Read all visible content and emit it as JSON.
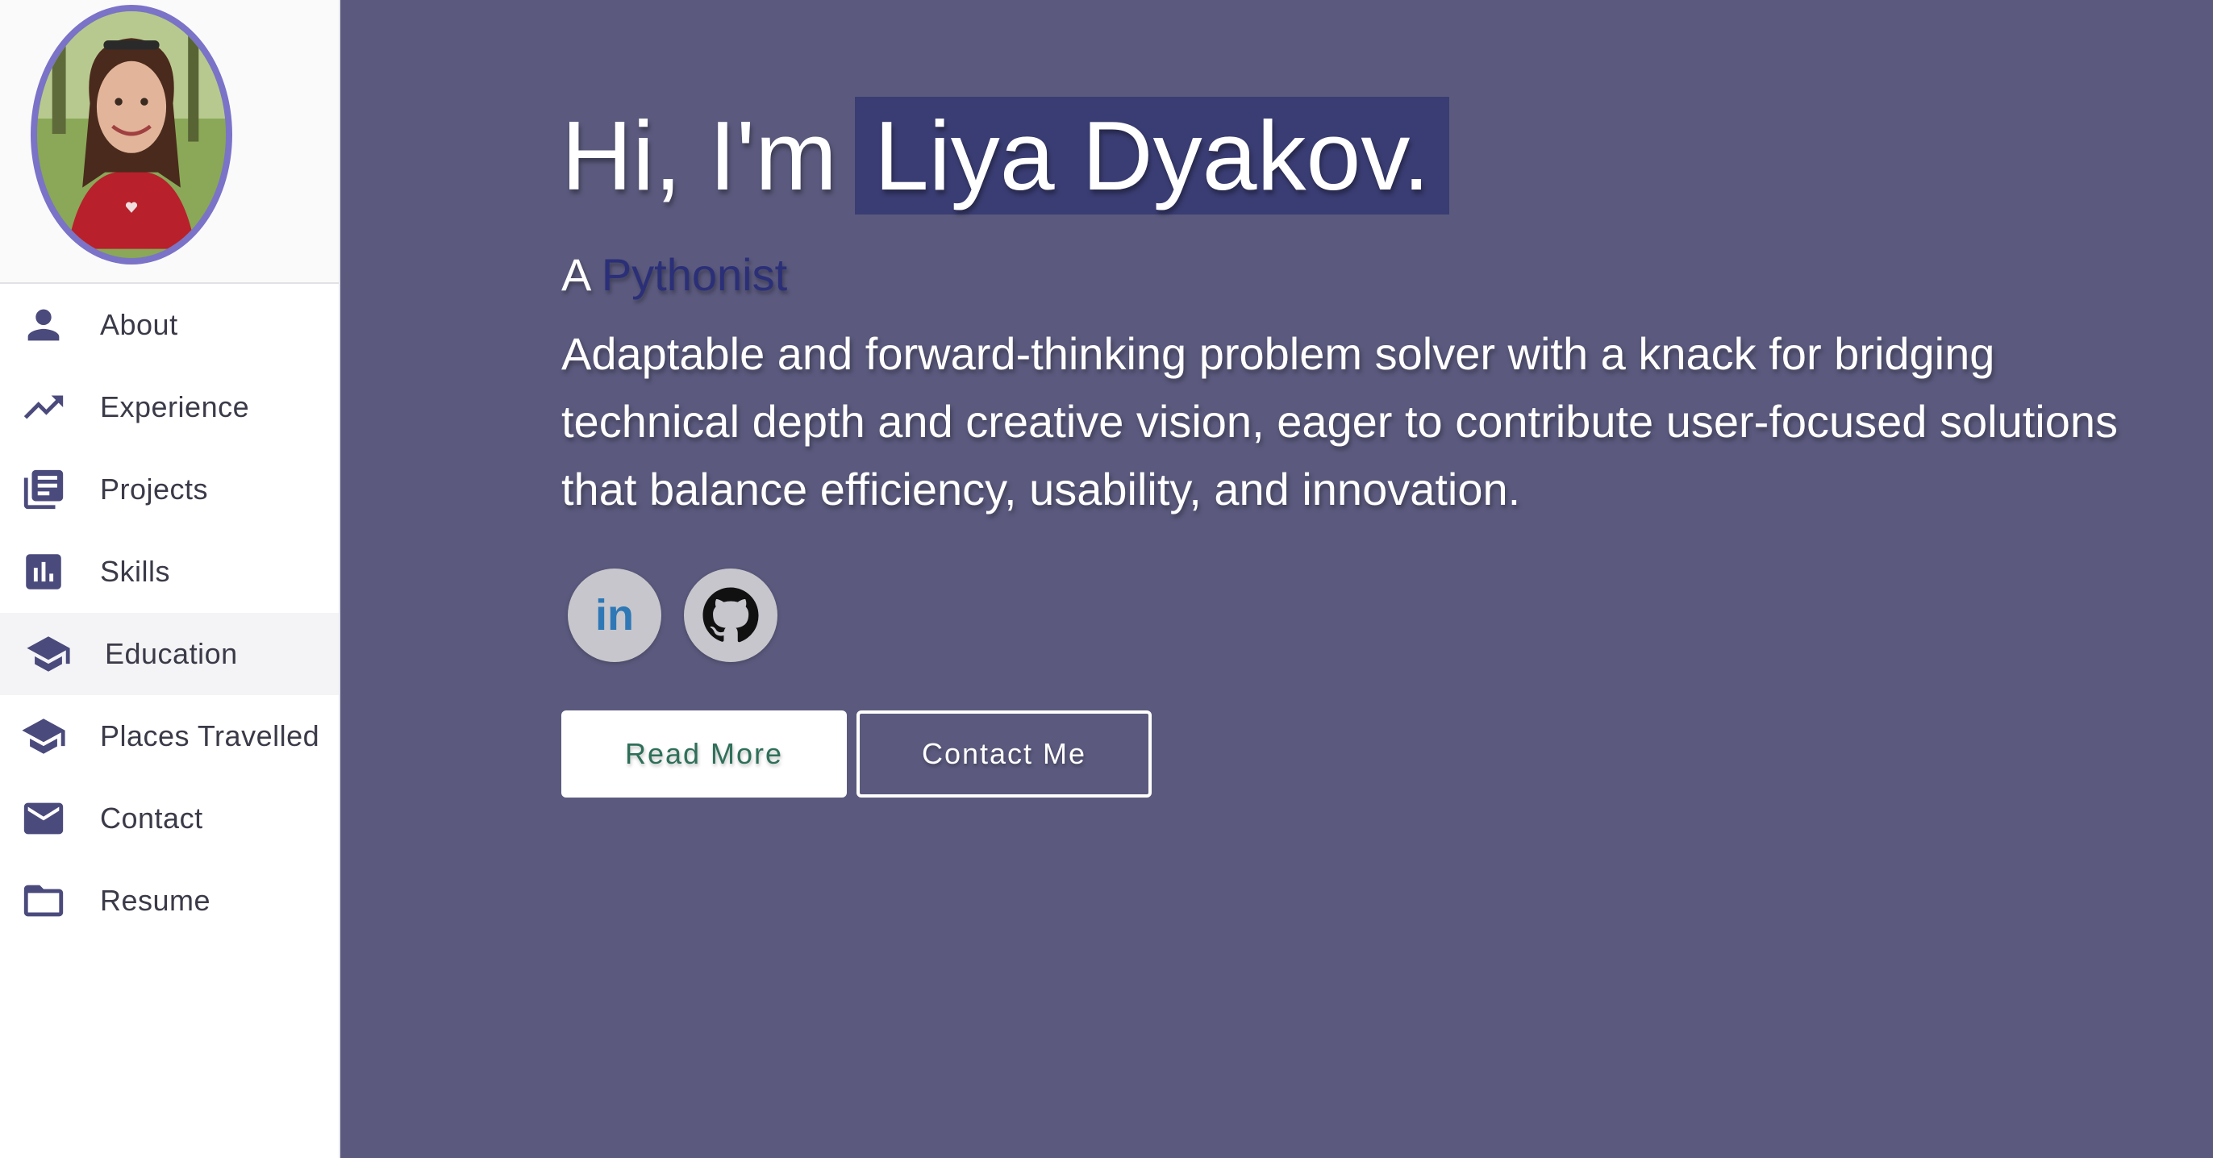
{
  "sidebar": {
    "items": [
      {
        "label": "About",
        "icon": "person-icon"
      },
      {
        "label": "Experience",
        "icon": "trending-up-icon"
      },
      {
        "label": "Projects",
        "icon": "library-books-icon"
      },
      {
        "label": "Skills",
        "icon": "bar-chart-icon"
      },
      {
        "label": "Education",
        "icon": "graduation-cap-icon",
        "active": true
      },
      {
        "label": "Places Travelled",
        "icon": "graduation-cap-icon"
      },
      {
        "label": "Contact",
        "icon": "mail-icon"
      },
      {
        "label": "Resume",
        "icon": "folder-icon"
      }
    ]
  },
  "hero": {
    "greeting": "Hi, I'm",
    "name": "Liya Dyakov.",
    "tagline_prefix": "A",
    "tagline_role": "Pythonist",
    "bio": "Adaptable and forward-thinking problem solver with a knack for bridging technical depth and creative vision, eager to contribute user-focused solutions that balance efficiency, usability, and innovation.",
    "socials": [
      {
        "icon": "linkedin-icon",
        "text": "in"
      },
      {
        "icon": "github-icon"
      }
    ],
    "read_more_label": "Read More",
    "contact_label": "Contact Me"
  },
  "colors": {
    "background": "#5b5a7e",
    "name_highlight": "#3a3d73",
    "role_text": "#2b2f78",
    "avatar_border": "#7a73c8",
    "nav_icon": "#4a4a7c",
    "linkedin": "#2e78b6"
  }
}
